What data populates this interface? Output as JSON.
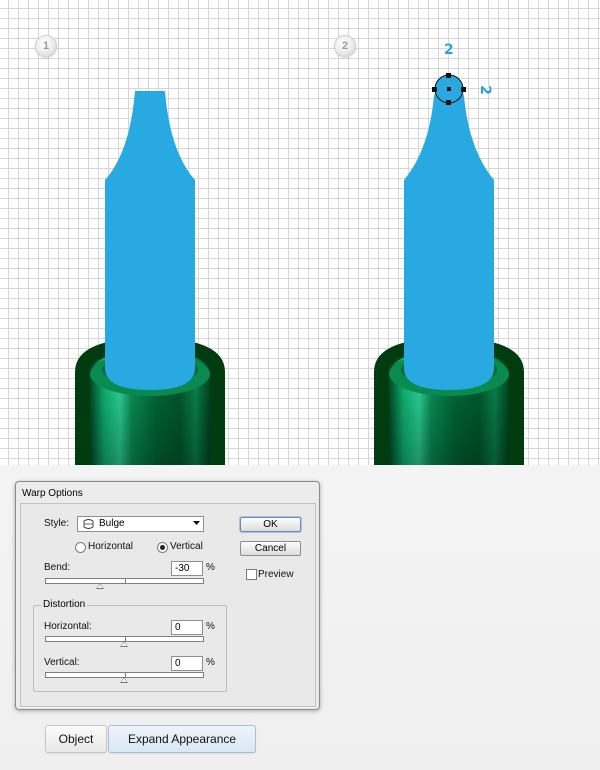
{
  "canvas": {
    "step_badges": [
      "1",
      "2"
    ],
    "measurements": [
      "2",
      "2"
    ]
  },
  "warp_dialog": {
    "title": "Warp Options",
    "style_label": "Style:",
    "style_value": "Bulge",
    "style_icon": "bulge-warp-icon",
    "orientation_options": [
      "Horizontal",
      "Vertical"
    ],
    "orientation_selected": "Vertical",
    "bend_label": "Bend:",
    "bend_value": "-30",
    "bend_unit": "%",
    "bend_percent": -30,
    "distortion_group_label": "Distortion",
    "horizontal_label": "Horizontal:",
    "horizontal_value": "0",
    "horizontal_unit": "%",
    "horizontal_percent": 0,
    "vertical_label": "Vertical:",
    "vertical_value": "0",
    "vertical_unit": "%",
    "vertical_percent": 0,
    "ok_label": "OK",
    "cancel_label": "Cancel",
    "preview_label": "Preview",
    "preview_checked": false
  },
  "control_panel": {
    "object_label": "Object",
    "expand_appearance_label": "Expand Appearance"
  },
  "colors": {
    "shape_blue": "#29a9e1",
    "measure_blue": "#2a9fe0",
    "green_dark": "#003a0d",
    "green_mid": "#006f3c",
    "green_light": "#15d48f"
  }
}
